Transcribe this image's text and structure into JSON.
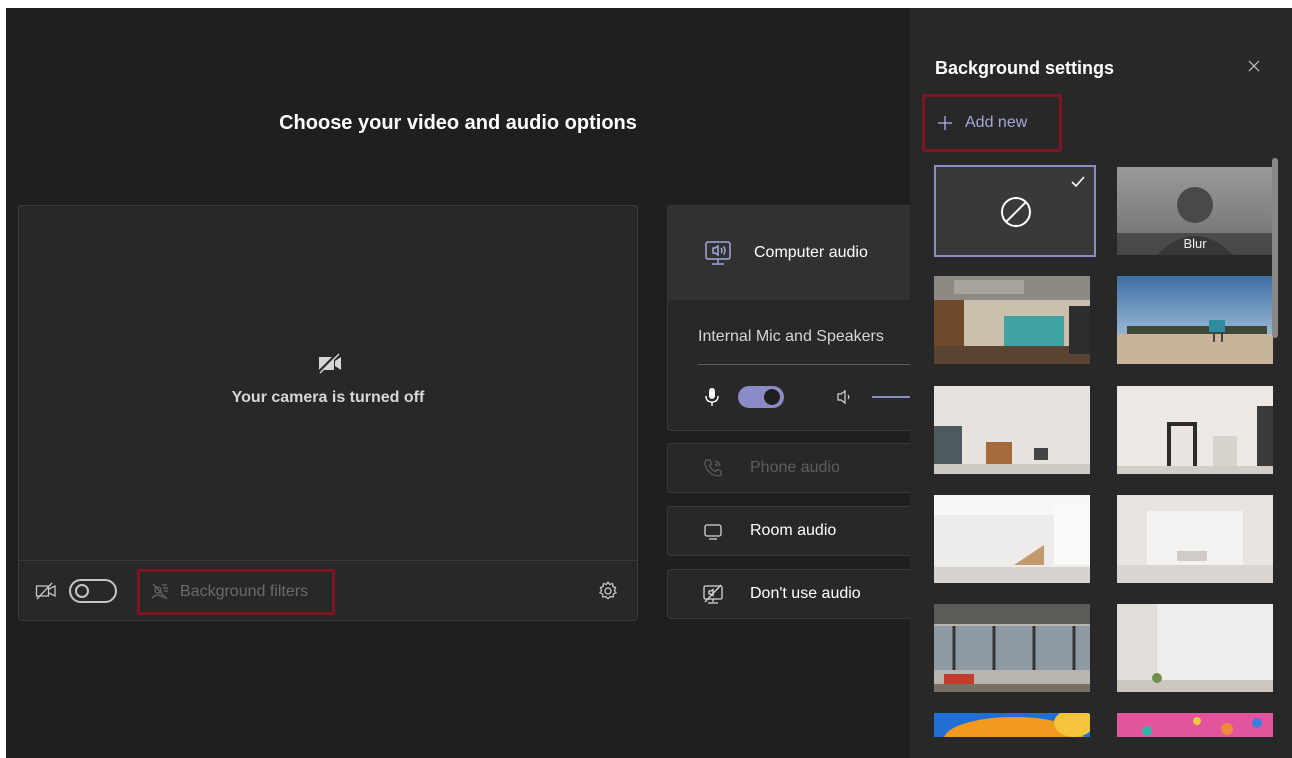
{
  "main": {
    "title": "Choose your video and audio options",
    "camera_status": "Your camera is turned off",
    "background_filters_label": "Background filters"
  },
  "audio": {
    "selected_option": "Computer audio",
    "device_name": "Internal Mic and Speakers",
    "mic_on": true,
    "options": [
      {
        "label": "Phone audio",
        "icon": "phone-icon",
        "enabled": false
      },
      {
        "label": "Room audio",
        "icon": "monitor-icon",
        "enabled": true
      },
      {
        "label": "Don't use audio",
        "icon": "audio-off-icon",
        "enabled": true
      }
    ]
  },
  "background_settings": {
    "title": "Background settings",
    "add_new_label": "Add new",
    "selected": "none",
    "thumbnails": [
      {
        "name": "none",
        "label": ""
      },
      {
        "name": "blur",
        "label": "Blur"
      },
      {
        "name": "office-lounge",
        "label": ""
      },
      {
        "name": "beach-lifeguard",
        "label": ""
      },
      {
        "name": "white-room-window",
        "label": ""
      },
      {
        "name": "white-room-mirror",
        "label": ""
      },
      {
        "name": "white-loft-stairs",
        "label": ""
      },
      {
        "name": "white-studio",
        "label": ""
      },
      {
        "name": "industrial-loft",
        "label": ""
      },
      {
        "name": "white-corner-room",
        "label": ""
      },
      {
        "name": "orange-abstract",
        "label": ""
      },
      {
        "name": "pink-abstract",
        "label": ""
      }
    ]
  },
  "colors": {
    "accent": "#8b8cc7",
    "highlight_box": "#7d1622",
    "background": "#201f1f",
    "panel": "#292828"
  }
}
